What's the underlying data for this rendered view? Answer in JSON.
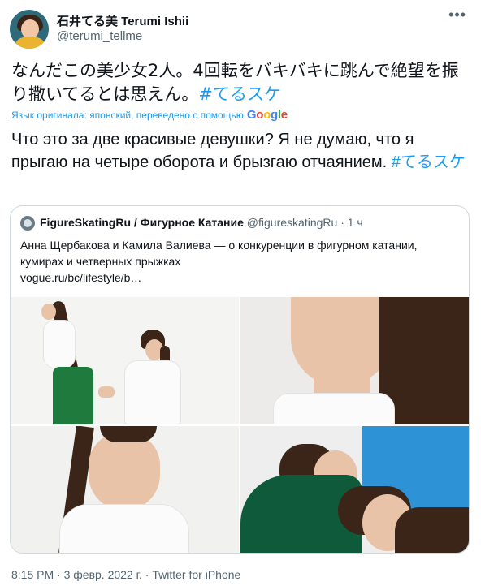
{
  "author": {
    "name": "石井てる美 Terumi Ishii",
    "handle": "@terumi_tellme"
  },
  "more_icon": "more-horizontal-icon",
  "tweet": {
    "text": "なんだこの美少女2人。4回転をバキバキに跳んで絶望を振り撒いてるとは思えん。",
    "hashtag": "#てるスケ",
    "translation_note": "Язык оригинала: японский, переведено с помощью",
    "translation_provider": "Google",
    "translated_text": "Что это за две красивые девушки? Я не думаю, что я прыгаю на четыре оборота и брызгаю отчаянием.",
    "translated_hashtag": "#てるスケ"
  },
  "quote": {
    "name": "FigureSkatingRu / Фигурное Катание",
    "handle": "@figureskatingRu",
    "separator": "·",
    "time": "1 ч",
    "text": "Анна Щербакова и Камила Валиева — о конкуренции в фигурном катании, кумирах и четверных прыжках",
    "link": "vogue.ru/bc/lifestyle/b…"
  },
  "footer": {
    "time": "8:15 PM",
    "dot1": "·",
    "date": "3 февр. 2022 г.",
    "dot2": "·",
    "source": "Twitter for iPhone"
  },
  "colors": {
    "link": "#1d9bf0",
    "text": "#0f1419",
    "secondary": "#536471",
    "border": "#cfd9de"
  }
}
